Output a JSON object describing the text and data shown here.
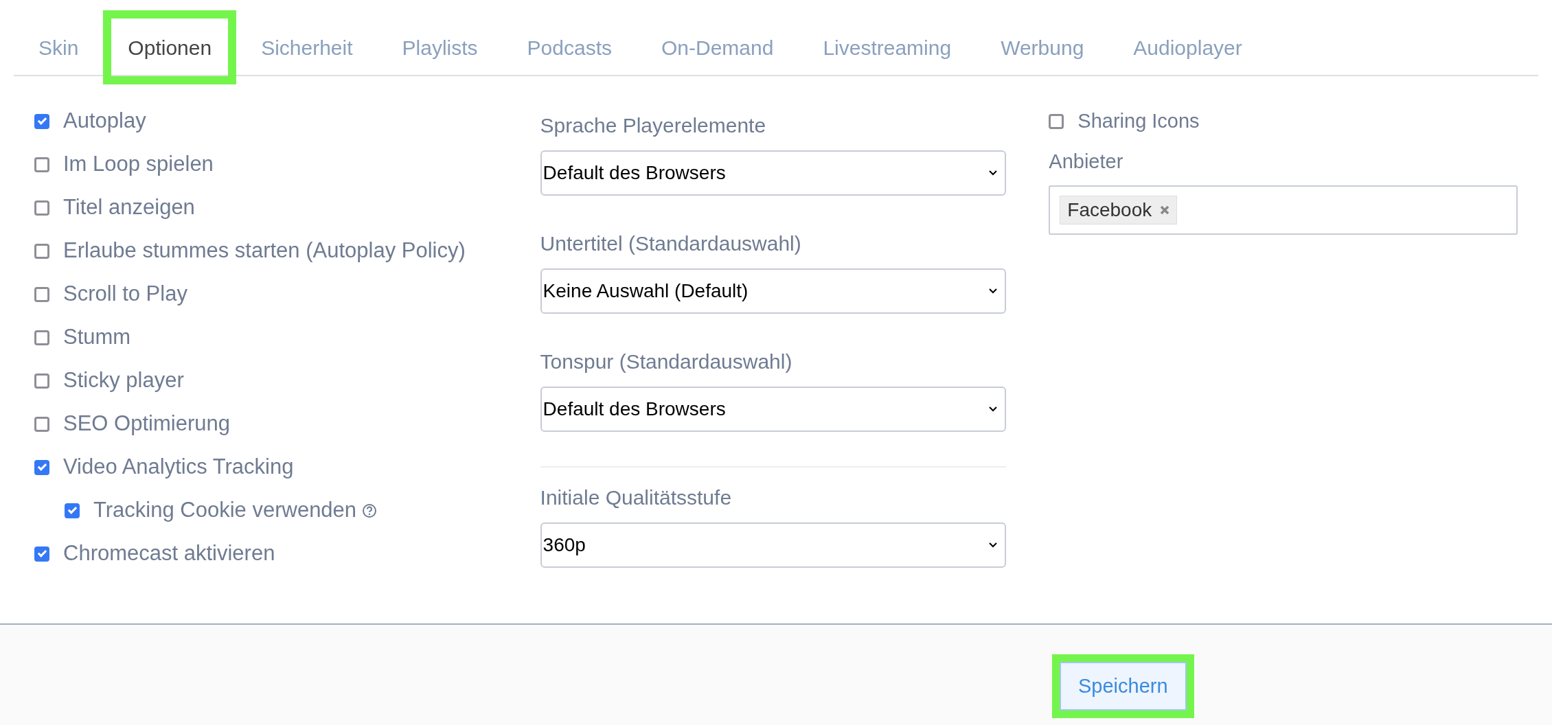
{
  "tabs": [
    {
      "label": "Skin",
      "selected": false,
      "highlighted": false
    },
    {
      "label": "Optionen",
      "selected": true,
      "highlighted": true
    },
    {
      "label": "Sicherheit",
      "selected": false,
      "highlighted": false
    },
    {
      "label": "Playlists",
      "selected": false,
      "highlighted": false
    },
    {
      "label": "Podcasts",
      "selected": false,
      "highlighted": false
    },
    {
      "label": "On-Demand",
      "selected": false,
      "highlighted": false
    },
    {
      "label": "Livestreaming",
      "selected": false,
      "highlighted": false
    },
    {
      "label": "Werbung",
      "selected": false,
      "highlighted": false
    },
    {
      "label": "Audioplayer",
      "selected": false,
      "highlighted": false
    }
  ],
  "options": [
    {
      "label": "Autoplay",
      "checked": true
    },
    {
      "label": "Im Loop spielen",
      "checked": false
    },
    {
      "label": "Titel anzeigen",
      "checked": false
    },
    {
      "label": "Erlaube stummes starten (Autoplay Policy)",
      "checked": false
    },
    {
      "label": "Scroll to Play",
      "checked": false
    },
    {
      "label": "Stumm",
      "checked": false
    },
    {
      "label": "Sticky player",
      "checked": false
    },
    {
      "label": "SEO Optimierung",
      "checked": false
    },
    {
      "label": "Video Analytics Tracking",
      "checked": true,
      "children": [
        {
          "label": "Tracking Cookie verwenden",
          "checked": true,
          "help": true
        }
      ]
    },
    {
      "label": "Chromecast aktivieren",
      "checked": true
    }
  ],
  "selects": [
    {
      "label": "Sprache Playerelemente",
      "value": "Default des Browsers",
      "divider_before": false
    },
    {
      "label": "Untertitel (Standardauswahl)",
      "value": "Keine Auswahl (Default)",
      "divider_before": false
    },
    {
      "label": "Tonspur (Standardauswahl)",
      "value": "Default des Browsers",
      "divider_before": false
    },
    {
      "label": "Initiale Qualitätsstufe",
      "value": "360p",
      "divider_before": true
    }
  ],
  "sharing": {
    "label": "Sharing Icons",
    "checked": false
  },
  "provider": {
    "label": "Anbieter",
    "tags": [
      "Facebook"
    ]
  },
  "save_button": {
    "label": "Speichern",
    "highlighted": true
  }
}
